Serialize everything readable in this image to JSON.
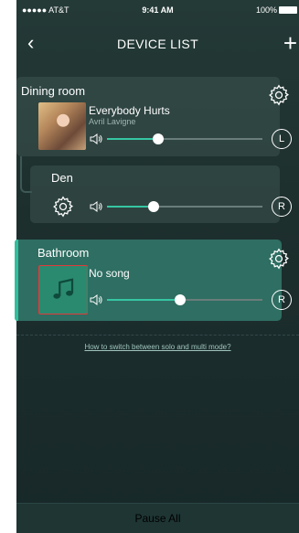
{
  "status_bar": {
    "carrier": "●●●●● AT&T",
    "time": "9:41 AM",
    "battery": "100%"
  },
  "nav": {
    "back_icon": "‹",
    "title": "DEVICE LIST",
    "add_icon": "+"
  },
  "devices": [
    {
      "room": "Dining room",
      "song": "Everybody Hurts",
      "artist": "Avril Lavigne",
      "cover": "album-art-avril",
      "volume": 0.33,
      "mode": "L"
    },
    {
      "room": "Den",
      "volume": 0.3,
      "mode": "R"
    },
    {
      "room": "Bathroom",
      "song": "No song",
      "cover": "music-note-icon",
      "volume": 0.47,
      "mode": "R"
    }
  ],
  "help_link": "How to switch between solo and multi mode?",
  "pause_all": "Pause All",
  "colors": {
    "accent": "#36c6a2",
    "bathroom_card": "#2f6e62",
    "background": "#1d2f2d"
  }
}
